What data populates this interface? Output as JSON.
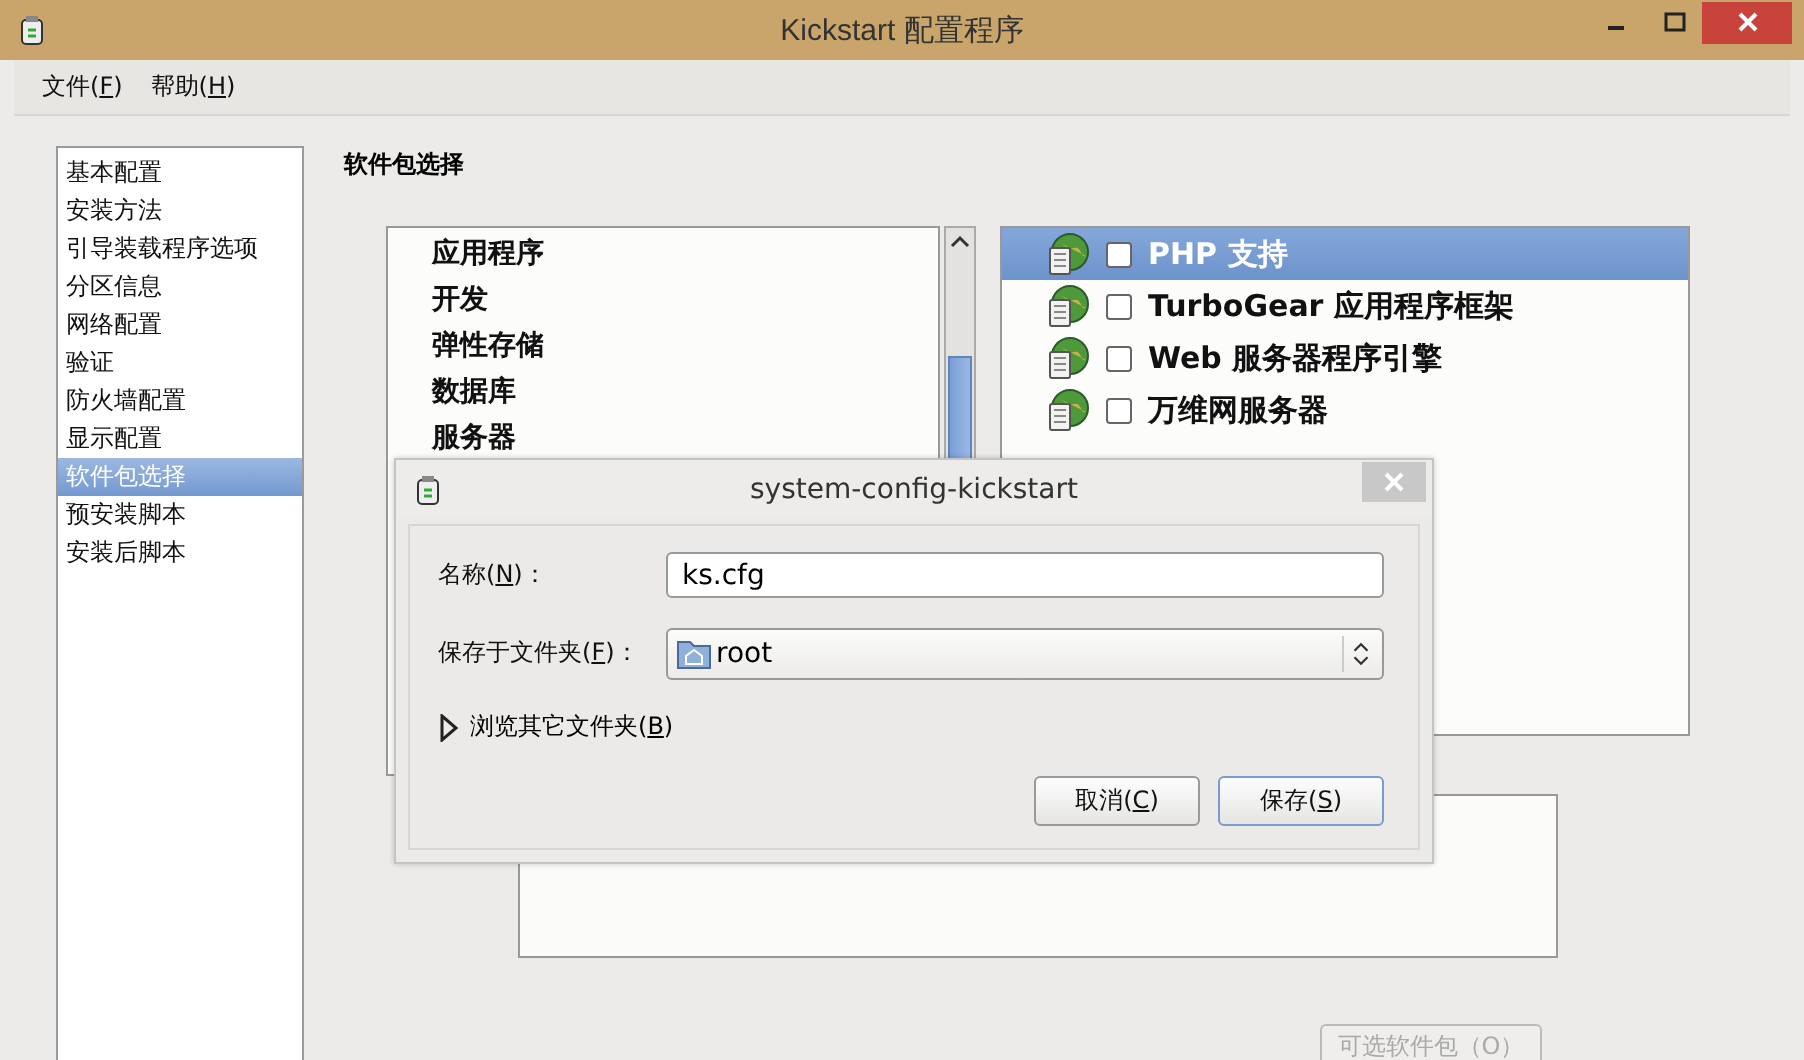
{
  "window": {
    "title": "Kickstart 配置程序"
  },
  "menu": [
    {
      "text": "文件(",
      "key": "F",
      "end": ")"
    },
    {
      "text": "帮助(",
      "key": "H",
      "end": ")"
    }
  ],
  "sidebar": {
    "items": [
      {
        "label": "基本配置",
        "selected": false
      },
      {
        "label": "安装方法",
        "selected": false
      },
      {
        "label": "引导装载程序选项",
        "selected": false
      },
      {
        "label": "分区信息",
        "selected": false
      },
      {
        "label": "网络配置",
        "selected": false
      },
      {
        "label": "验证",
        "selected": false
      },
      {
        "label": "防火墙配置",
        "selected": false
      },
      {
        "label": "显示配置",
        "selected": false
      },
      {
        "label": "软件包选择",
        "selected": true
      },
      {
        "label": "预安装脚本",
        "selected": false
      },
      {
        "label": "安装后脚本",
        "selected": false
      }
    ]
  },
  "heading": "软件包选择",
  "groups": [
    {
      "label": "应用程序",
      "selected": false
    },
    {
      "label": "开发",
      "selected": false
    },
    {
      "label": "弹性存储",
      "selected": false
    },
    {
      "label": "数据库",
      "selected": false
    },
    {
      "label": "服务器",
      "selected": false
    }
  ],
  "packages": [
    {
      "label": "PHP 支持",
      "checked": false,
      "selected": true
    },
    {
      "label": "TurboGear 应用程序框架",
      "checked": false,
      "selected": false
    },
    {
      "label": "Web 服务器程序引擎",
      "checked": false,
      "selected": false
    },
    {
      "label": "万维网服务器",
      "checked": false,
      "selected": false
    }
  ],
  "optional_button": {
    "label": "可选软件包（O）",
    "disabled": true
  },
  "dialog": {
    "title": "system-config-kickstart",
    "fields": [
      {
        "kind": "text",
        "label": {
          "text": "名称(",
          "key": "N",
          "end": ")："
        },
        "value": "ks.cfg"
      },
      {
        "kind": "combo",
        "label": {
          "text": "保存于文件夹(",
          "key": "F",
          "end": ")："
        },
        "value": "root"
      }
    ],
    "expander": {
      "text": "浏览其它文件夹(",
      "key": "B",
      "end": ")",
      "expanded": false
    },
    "buttons": [
      {
        "text": "取消(",
        "key": "C",
        "end": ")",
        "default": false
      },
      {
        "text": "保存(",
        "key": "S",
        "end": ")",
        "default": true
      }
    ]
  }
}
